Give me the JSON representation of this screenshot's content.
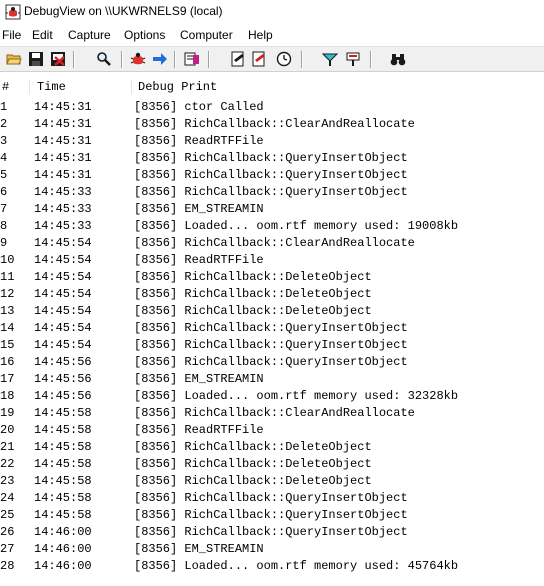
{
  "window": {
    "title": "DebugView on \\\\UKWRNELS9 (local)"
  },
  "menu": [
    "File",
    "Edit",
    "Capture",
    "Options",
    "Computer",
    "Help"
  ],
  "toolbar": {
    "icons": [
      "open-icon",
      "save-icon",
      "clear-display-icon",
      "find-icon",
      "capture-icon",
      "autoscroll-icon",
      "clock-icon",
      "highlight-icon",
      "filter-icon",
      "options-icon",
      "time-format-icon",
      "history-icon",
      "send-icon",
      "search-binoculars-icon"
    ]
  },
  "columns": {
    "num": "#",
    "time": "Time",
    "print": "Debug Print"
  },
  "rows": [
    {
      "num": "1",
      "time": "14:45:31",
      "print": "[8356] ctor Called"
    },
    {
      "num": "2",
      "time": "14:45:31",
      "print": "[8356] RichCallback::ClearAndReallocate"
    },
    {
      "num": "3",
      "time": "14:45:31",
      "print": "[8356] ReadRTFFile"
    },
    {
      "num": "4",
      "time": "14:45:31",
      "print": "[8356] RichCallback::QueryInsertObject"
    },
    {
      "num": "5",
      "time": "14:45:31",
      "print": "[8356] RichCallback::QueryInsertObject"
    },
    {
      "num": "6",
      "time": "14:45:33",
      "print": "[8356] RichCallback::QueryInsertObject"
    },
    {
      "num": "7",
      "time": "14:45:33",
      "print": "[8356] EM_STREAMIN"
    },
    {
      "num": "8",
      "time": "14:45:33",
      "print": "[8356] Loaded... oom.rtf memory used: 19008kb"
    },
    {
      "num": "9",
      "time": "14:45:54",
      "print": "[8356] RichCallback::ClearAndReallocate"
    },
    {
      "num": "10",
      "time": "14:45:54",
      "print": "[8356] ReadRTFFile"
    },
    {
      "num": "11",
      "time": "14:45:54",
      "print": "[8356] RichCallback::DeleteObject"
    },
    {
      "num": "12",
      "time": "14:45:54",
      "print": "[8356] RichCallback::DeleteObject"
    },
    {
      "num": "13",
      "time": "14:45:54",
      "print": "[8356] RichCallback::DeleteObject"
    },
    {
      "num": "14",
      "time": "14:45:54",
      "print": "[8356] RichCallback::QueryInsertObject"
    },
    {
      "num": "15",
      "time": "14:45:54",
      "print": "[8356] RichCallback::QueryInsertObject"
    },
    {
      "num": "16",
      "time": "14:45:56",
      "print": "[8356] RichCallback::QueryInsertObject"
    },
    {
      "num": "17",
      "time": "14:45:56",
      "print": "[8356] EM_STREAMIN"
    },
    {
      "num": "18",
      "time": "14:45:56",
      "print": "[8356] Loaded... oom.rtf memory used: 32328kb"
    },
    {
      "num": "19",
      "time": "14:45:58",
      "print": "[8356] RichCallback::ClearAndReallocate"
    },
    {
      "num": "20",
      "time": "14:45:58",
      "print": "[8356] ReadRTFFile"
    },
    {
      "num": "21",
      "time": "14:45:58",
      "print": "[8356] RichCallback::DeleteObject"
    },
    {
      "num": "22",
      "time": "14:45:58",
      "print": "[8356] RichCallback::DeleteObject"
    },
    {
      "num": "23",
      "time": "14:45:58",
      "print": "[8356] RichCallback::DeleteObject"
    },
    {
      "num": "24",
      "time": "14:45:58",
      "print": "[8356] RichCallback::QueryInsertObject"
    },
    {
      "num": "25",
      "time": "14:45:58",
      "print": "[8356] RichCallback::QueryInsertObject"
    },
    {
      "num": "26",
      "time": "14:46:00",
      "print": "[8356] RichCallback::QueryInsertObject"
    },
    {
      "num": "27",
      "time": "14:46:00",
      "print": "[8356] EM_STREAMIN"
    },
    {
      "num": "28",
      "time": "14:46:00",
      "print": "[8356] Loaded... oom.rtf memory used: 45764kb"
    }
  ]
}
